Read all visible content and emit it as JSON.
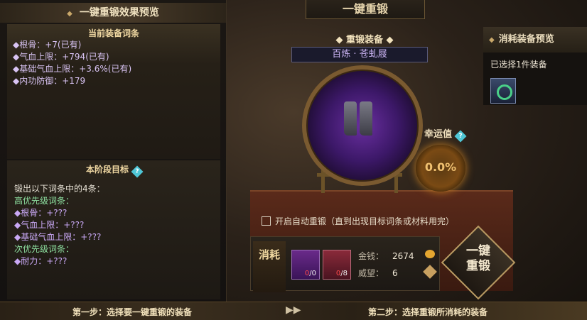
{
  "title": "一键重锻",
  "left_panel": {
    "header": "一键重锻效果预览",
    "current": {
      "title": "当前装备词条",
      "attrs": [
        "◆根骨：+7(已有)",
        "◆气血上限：+794(已有)",
        "◆基础气血上限：+3.6%(已有)",
        "◆内功防御：+179"
      ]
    },
    "goal": {
      "title": "本阶段目标",
      "help": "?",
      "intro": "锻出以下词条中的4条：",
      "high_label": "高优先级词条：",
      "high": [
        "◆根骨：+???",
        "◆气血上限：+???",
        "◆基础气血上限：+???"
      ],
      "low_label": "次优先级词条：",
      "low": [
        "◆耐力：+???"
      ]
    }
  },
  "forge": {
    "label": "◆ 重锻装备 ◆",
    "item_name": "百炼 · 苍虬屐"
  },
  "luck": {
    "label": "幸运值",
    "help": "?",
    "value": "0.0%"
  },
  "auto": {
    "label": "开启自动重锻（直到出现目标词条或材料用完）",
    "checked": false
  },
  "consume": {
    "label": "消耗",
    "slots": [
      {
        "count_have": "0",
        "count_need": "/0"
      },
      {
        "count_have": "0",
        "count_need": "/8"
      }
    ],
    "money_label": "金钱：",
    "money_value": "2674",
    "rep_label": "威望：",
    "rep_value": "6"
  },
  "button": {
    "line1": "一键",
    "line2": "重锻"
  },
  "right_panel": {
    "header": "消耗装备预览",
    "selected": "已选择1件装备"
  },
  "footer": {
    "step1": "第一步：选择要一键重锻的装备",
    "arrow": "▶▶",
    "step2": "第二步：选择重锻所消耗的装备"
  }
}
